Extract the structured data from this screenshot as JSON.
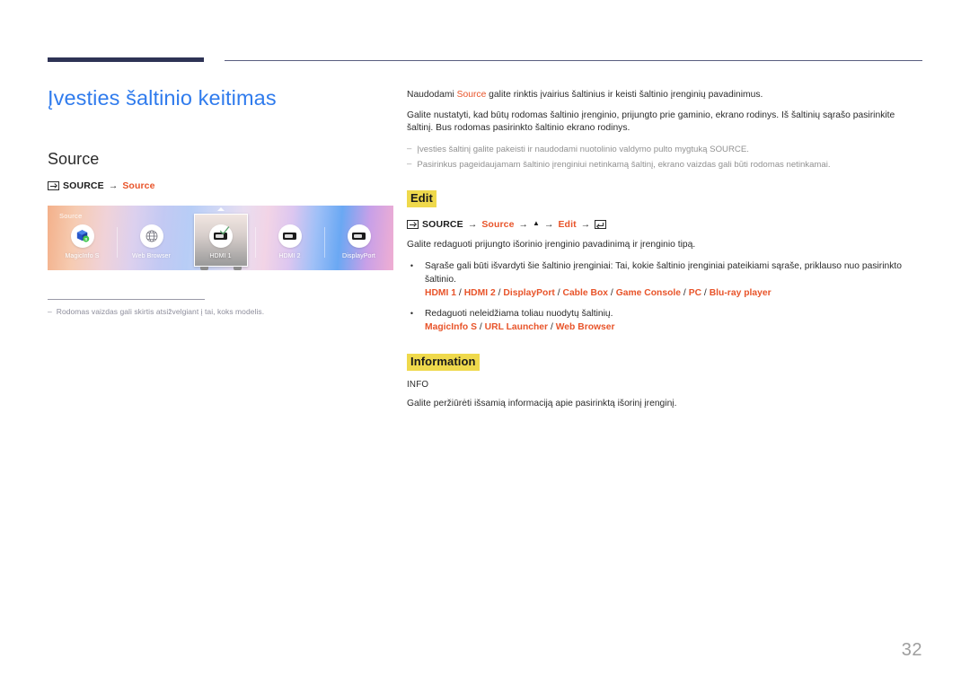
{
  "page": {
    "number": "32"
  },
  "left": {
    "chapter_title": "Įvesties šaltinio keitimas",
    "section_title": "Source",
    "menu_path": {
      "source_icon": "source-input-icon",
      "key": "SOURCE",
      "arrow": "→",
      "value": "Source"
    },
    "screenshot": {
      "label": "Source",
      "items": [
        {
          "name": "MagicInfo S",
          "icon": "magicinfo-icon",
          "selected": false
        },
        {
          "name": "Web Browser",
          "icon": "globe-icon",
          "selected": false
        },
        {
          "name": "HDMI 1",
          "icon": "hdmi-port-icon",
          "selected": true,
          "check": "check-icon"
        },
        {
          "name": "HDMI 2",
          "icon": "hdmi-port-icon",
          "selected": false
        },
        {
          "name": "DisplayPort",
          "icon": "hdmi-port-icon",
          "selected": false
        }
      ]
    },
    "note": {
      "dash": "‒",
      "text": "Rodomas vaizdas gali skirtis atsižvelgiant į tai, koks modelis."
    }
  },
  "right": {
    "intro": {
      "pre": "Naudodami ",
      "keyword": "Source",
      "post": " galite rinktis įvairius šaltinius ir keisti šaltinio įrenginių pavadinimus."
    },
    "paragraph": "Galite nustatyti, kad būtų rodomas šaltinio įrenginio, prijungto prie gaminio, ekrano rodinys. Iš šaltinių sąrašo pasirinkite šaltinį. Bus rodomas pasirinkto šaltinio ekrano rodinys.",
    "notes": [
      {
        "dash": "‒",
        "text": "Įvesties šaltinį galite pakeisti ir naudodami nuotolinio valdymo pulto mygtuką SOURCE."
      },
      {
        "dash": "‒",
        "text": "Pasirinkus pageidaujamam šaltinio įrenginiui netinkamą šaltinį, ekrano vaizdas gali būti rodomas netinkamai."
      }
    ],
    "edit": {
      "heading": "Edit",
      "highlight_color": "#EFD94C",
      "menu_path": {
        "source_icon": "source-input-icon",
        "key": "SOURCE",
        "a1": "→",
        "v1": "Source",
        "a2": "→",
        "up": "▲",
        "a3": "→",
        "v2": "Edit",
        "a4": "→",
        "enter_icon": "enter-key-icon"
      },
      "lead": "Galite redaguoti prijungto išorinio įrenginio pavadinimą ir įrenginio tipą.",
      "bullets": [
        {
          "marker": "•",
          "text": "Sąraše gali būti išvardyti šie šaltinio įrenginiai: Tai, kokie šaltinio įrenginiai pateikiami sąraše, priklauso nuo pasirinkto šaltinio.",
          "sources": [
            "HDMI 1",
            "HDMI 2",
            "DisplayPort",
            "Cable Box",
            "Game Console",
            "PC",
            "Blu-ray player"
          ]
        },
        {
          "marker": "•",
          "text": "Redaguoti neleidžiama toliau nuodytų šaltinių.",
          "sources": [
            "MagicInfo S",
            "URL Launcher",
            "Web Browser"
          ]
        }
      ],
      "source_separator": " / "
    },
    "information": {
      "heading": "Information",
      "highlight_color": "#EFD94C",
      "label": "INFO",
      "body": "Galite peržiūrėti išsamią informaciją apie pasirinktą išorinį įrenginį."
    }
  },
  "colors": {
    "accent_blue": "#2F7BED",
    "accent_orange": "#E8542A",
    "rule_navy": "#2E3355",
    "highlight_yellow": "#EFD94C",
    "muted_gray": "#8E8E9C"
  }
}
